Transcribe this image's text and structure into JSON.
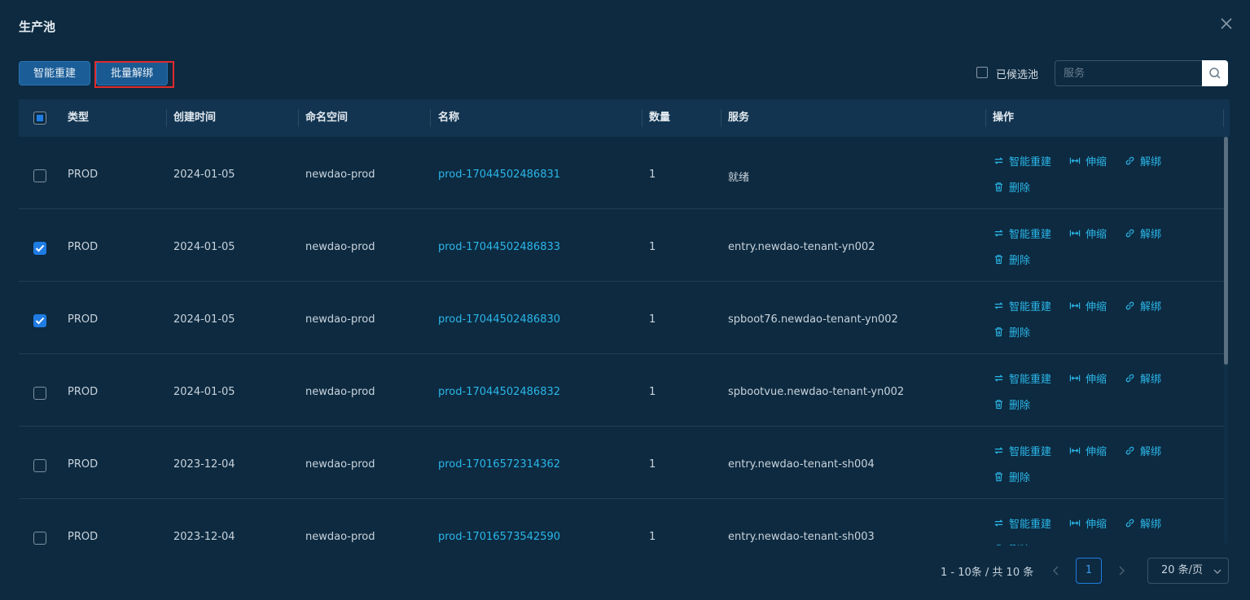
{
  "modal": {
    "title": "生产池"
  },
  "toolbar": {
    "rebuild_label": "智能重建",
    "batch_unbind_label": "批量解绑",
    "pool_label": "已候选池",
    "search_placeholder": "服务"
  },
  "columns": [
    "类型",
    "创建时间",
    "命名空间",
    "名称",
    "数量",
    "服务",
    "操作"
  ],
  "actions": {
    "rebuild": "智能重建",
    "scale": "伸缩",
    "unbind": "解绑",
    "delete": "删除"
  },
  "rows": [
    {
      "type": "PROD",
      "created": "2024-01-05",
      "namespace": "newdao-prod",
      "name": "prod-17044502486831",
      "count": "1",
      "service": "就绪",
      "checked": false
    },
    {
      "type": "PROD",
      "created": "2024-01-05",
      "namespace": "newdao-prod",
      "name": "prod-17044502486833",
      "count": "1",
      "service": "entry.newdao-tenant-yn002",
      "checked": true
    },
    {
      "type": "PROD",
      "created": "2024-01-05",
      "namespace": "newdao-prod",
      "name": "prod-17044502486830",
      "count": "1",
      "service": "spboot76.newdao-tenant-yn002",
      "checked": true
    },
    {
      "type": "PROD",
      "created": "2024-01-05",
      "namespace": "newdao-prod",
      "name": "prod-17044502486832",
      "count": "1",
      "service": "spbootvue.newdao-tenant-yn002",
      "checked": false
    },
    {
      "type": "PROD",
      "created": "2023-12-04",
      "namespace": "newdao-prod",
      "name": "prod-17016572314362",
      "count": "1",
      "service": "entry.newdao-tenant-sh004",
      "checked": false
    },
    {
      "type": "PROD",
      "created": "2023-12-04",
      "namespace": "newdao-prod",
      "name": "prod-17016573542590",
      "count": "1",
      "service": "entry.newdao-tenant-sh003",
      "checked": false
    }
  ],
  "pagination": {
    "total_text": "1 - 10条 / 共 10 条",
    "current_page": "1",
    "page_size": "20 条/页"
  },
  "colors": {
    "accent": "#1f7ce3",
    "link": "#2bb6e8",
    "highlight": "#e02b2b"
  }
}
